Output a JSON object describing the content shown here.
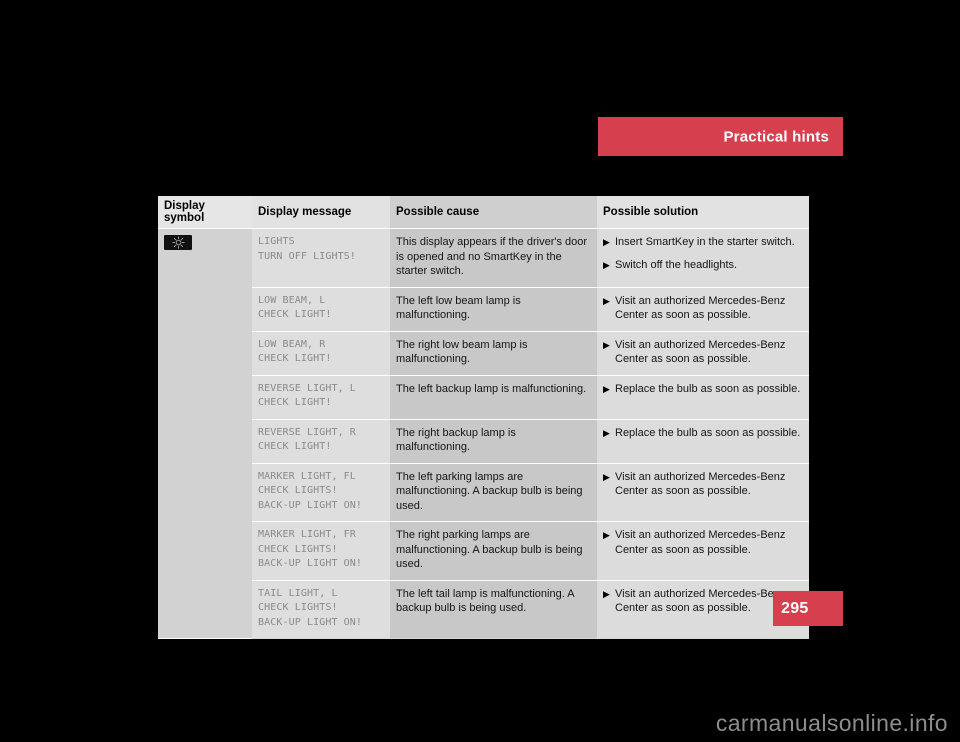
{
  "section_header": {
    "title": "Practical hints",
    "color": "#d6404e"
  },
  "page_number": {
    "value": "295",
    "color": "#d6404e"
  },
  "watermark": {
    "text": "carmanualsonline.info"
  },
  "table": {
    "columns": [
      "Display symbol",
      "Display message",
      "Possible cause",
      "Possible solution"
    ],
    "symbol": {
      "icon_name": "headlight-indicator-icon",
      "background": "#111111"
    },
    "rows": [
      {
        "message": [
          "LIGHTS",
          "TURN OFF LIGHTS!"
        ],
        "cause": "This display appears if the driver's door is opened and no SmartKey in the starter switch.",
        "solutions": [
          "Insert SmartKey in the starter switch.",
          "Switch off the headlights."
        ]
      },
      {
        "message": [
          "LOW BEAM, L",
          "CHECK LIGHT!"
        ],
        "cause": "The left low beam lamp is malfunctioning.",
        "solutions": [
          "Visit an authorized Mercedes-Benz Center as soon as possible."
        ]
      },
      {
        "message": [
          "LOW BEAM, R",
          "CHECK LIGHT!"
        ],
        "cause": "The right low beam lamp is malfunctioning.",
        "solutions": [
          "Visit an authorized Mercedes-Benz Center as soon as possible."
        ]
      },
      {
        "message": [
          "REVERSE LIGHT, L",
          "CHECK LIGHT!"
        ],
        "cause": "The left backup lamp is malfunctioning.",
        "solutions": [
          "Replace the bulb as soon as possible."
        ]
      },
      {
        "message": [
          "REVERSE LIGHT, R",
          "CHECK LIGHT!"
        ],
        "cause": "The right backup lamp is malfunctioning.",
        "solutions": [
          "Replace the bulb as soon as possible."
        ]
      },
      {
        "message": [
          "MARKER LIGHT, FL",
          "CHECK LIGHTS!",
          "BACK-UP LIGHT ON!"
        ],
        "cause": "The left parking lamps are malfunctioning. A backup bulb is being used.",
        "solutions": [
          "Visit an authorized Mercedes-Benz Center as soon as possible."
        ]
      },
      {
        "message": [
          "MARKER LIGHT, FR",
          "CHECK LIGHTS!",
          "BACK-UP LIGHT ON!"
        ],
        "cause": "The right parking lamps are malfunctioning. A backup bulb is being used.",
        "solutions": [
          "Visit an authorized Mercedes-Benz Center as soon as possible."
        ]
      },
      {
        "message": [
          "TAIL LIGHT, L",
          "CHECK LIGHTS!",
          "BACK-UP LIGHT ON!"
        ],
        "cause": "The left tail lamp is malfunctioning. A backup bulb is being used.",
        "solutions": [
          "Visit an authorized Mercedes-Benz Center as soon as possible."
        ]
      }
    ]
  }
}
